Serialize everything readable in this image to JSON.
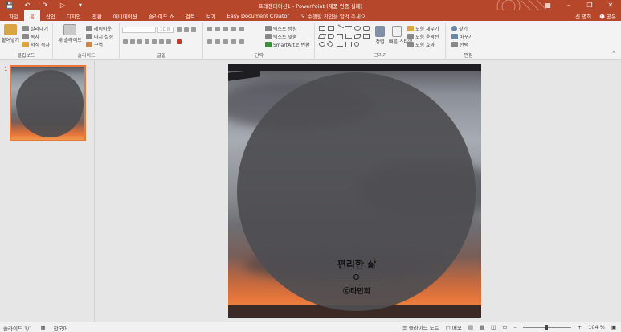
{
  "window": {
    "title": "프레젠테이션1 - PowerPoint (제품 인증 실패)",
    "accent": "#b7472a"
  },
  "tabs": [
    {
      "label": "파일",
      "active": false
    },
    {
      "label": "홈",
      "active": true
    },
    {
      "label": "삽입",
      "active": false
    },
    {
      "label": "디자인",
      "active": false
    },
    {
      "label": "전환",
      "active": false
    },
    {
      "label": "애니메이션",
      "active": false
    },
    {
      "label": "슬라이드 쇼",
      "active": false
    },
    {
      "label": "검토",
      "active": false
    },
    {
      "label": "보기",
      "active": false
    },
    {
      "label": "Easy Document Creator",
      "active": false
    }
  ],
  "tellme": {
    "placeholder": "수행할 작업을 알려 주세요."
  },
  "account": {
    "user": "신 명희",
    "share": "공유"
  },
  "ribbon": {
    "clipboard": {
      "paste": "붙여넣기",
      "cut": "잘라내기",
      "copy": "복사",
      "format_painter": "서식 복사",
      "label": "클립보드"
    },
    "slides": {
      "new_slide": "새 슬라이드",
      "layout": "레이아웃",
      "reset": "다시 설정",
      "section": "구역",
      "label": "슬라이드"
    },
    "font": {
      "font_size": "10.8",
      "label": "글꼴"
    },
    "paragraph": {
      "text_direction": "텍스트 방향",
      "align_text": "텍스트 맞춤",
      "smartart": "SmartArt로 변환",
      "label": "단락"
    },
    "drawing": {
      "arrange": "정렬",
      "quick_styles": "빠른 스타일",
      "shape_fill": "도형 채우기",
      "shape_outline": "도형 윤곽선",
      "shape_effects": "도형 효과",
      "label": "그리기"
    },
    "editing": {
      "find": "찾기",
      "replace": "바꾸기",
      "select": "선택",
      "label": "편집"
    }
  },
  "thumbnails": [
    {
      "number": "1"
    }
  ],
  "slide": {
    "title": "편리한 삶",
    "author": "ⓒ타민희"
  },
  "status": {
    "slide_info": "슬라이드 1/1",
    "language": "한국어",
    "notes": "슬라이드 노트",
    "comments": "메모",
    "zoom": "104 %"
  }
}
